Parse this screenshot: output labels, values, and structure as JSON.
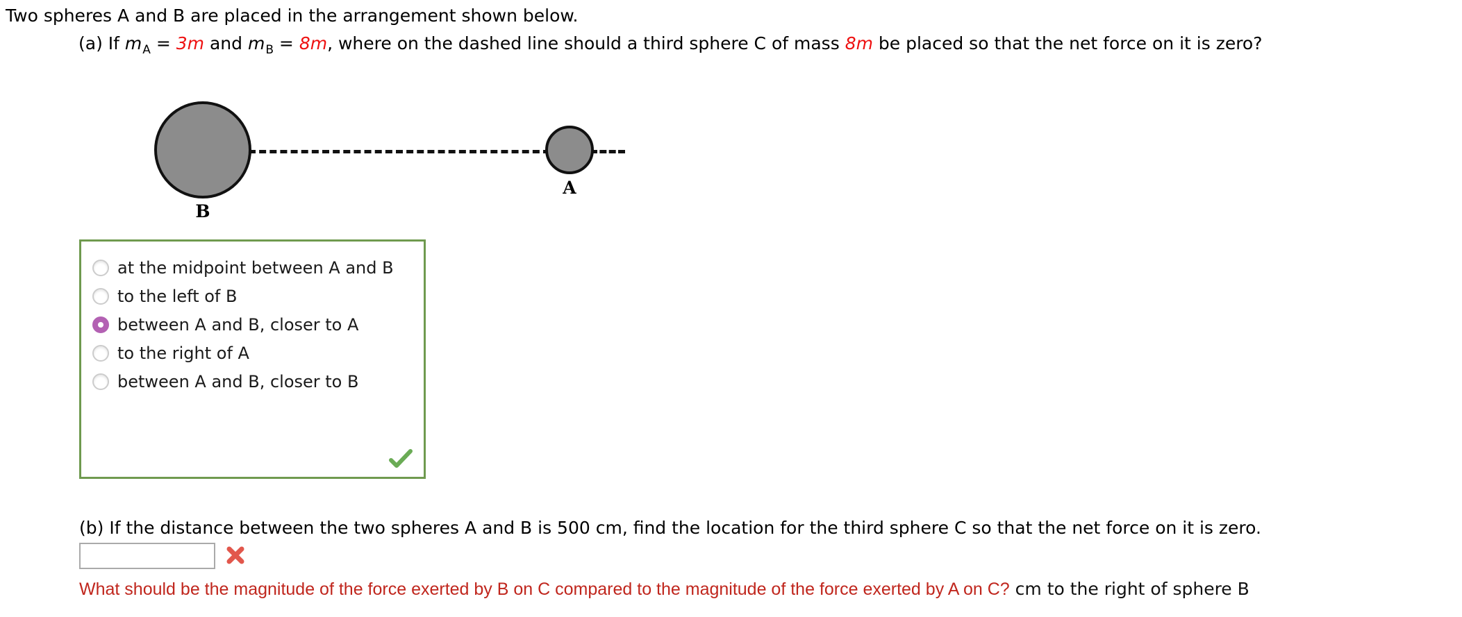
{
  "intro": {
    "text": "Two spheres A and B are placed in the arrangement shown below."
  },
  "part_a": {
    "prefix": "(a) If ",
    "m_symbol_1": "m",
    "sub_1": "A",
    "equals_1": " = ",
    "mass_a": "3m",
    "conjunction": " and ",
    "m_symbol_2": "m",
    "sub_2": "B",
    "equals_2": " = ",
    "mass_b": "8m",
    "question": ", where on the dashed line should a third sphere C of mass ",
    "mass_c": "8m",
    "question_end": " be placed so that the net force on it is zero?",
    "red_color": "#ee1111"
  },
  "diagram": {
    "sphere_b_label": "B",
    "sphere_a_label": "A",
    "sphere_fill": "#8c8c8c",
    "line_color": "#111111"
  },
  "choices": {
    "border_color": "#6f9a4f",
    "selected_color": "#b361b3",
    "selected_index": 2,
    "items": [
      {
        "label": "at the midpoint between A and B",
        "selected": false
      },
      {
        "label": "to the left of B",
        "selected": false
      },
      {
        "label": "between A and B, closer to A",
        "selected": true
      },
      {
        "label": "to the right of A",
        "selected": false
      },
      {
        "label": "between A and B, closer to B",
        "selected": false
      }
    ],
    "status_icon": "check-mark-icon",
    "status_color": "#6aab55"
  },
  "part_b": {
    "text": "(b) If the distance between the two spheres A and B is 500 cm, find the location for the third sphere C so that the net force on it is zero.",
    "input_value": "",
    "input_placeholder": "",
    "status_icon": "x-mark-icon",
    "status_color": "#e2574c"
  },
  "feedback": {
    "question": "What should be the magnitude of the force exerted by B on C compared to the magnitude of the force exerted by A on C?",
    "question_color": "#c0261d",
    "suffix": " cm to the right of sphere B",
    "suffix_color": "#111111"
  }
}
